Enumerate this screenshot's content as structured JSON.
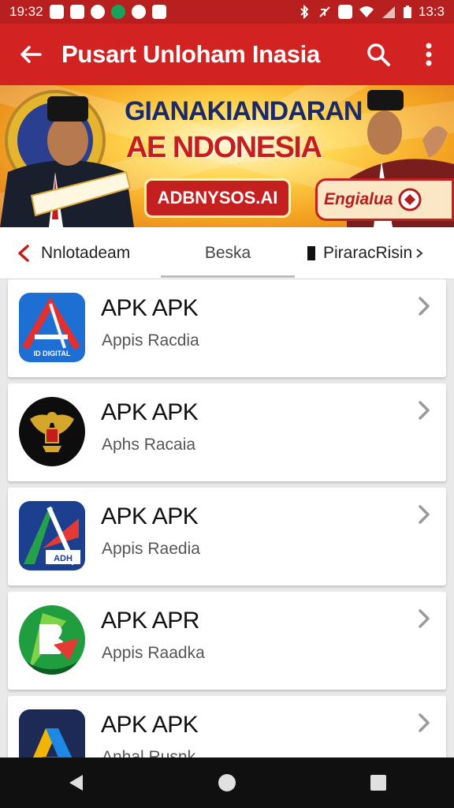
{
  "status_bar": {
    "time": "19:32",
    "right_time": "13:3"
  },
  "app_bar": {
    "title": "Pusart Unloham Inasia"
  },
  "banner": {
    "headline_1": "GIANAKIANDARAN",
    "headline_2": "AE NDONESIA",
    "button_label": "ADBNYSOS.AI",
    "badge_label": "Engialua"
  },
  "tabs": [
    {
      "label": "Nnlotadeam"
    },
    {
      "label": "Beska"
    },
    {
      "label": "PiraracRisin"
    }
  ],
  "apps": [
    {
      "name": "APK APK",
      "subtitle": "Appis Racdia",
      "icon": "red-a-logo-icon",
      "icon_caption": "ID DIGITAL"
    },
    {
      "name": "APK APK",
      "subtitle": "Aphs Racaia",
      "icon": "garuda-emblem-icon"
    },
    {
      "name": "APK APK",
      "subtitle": "Appis Raedia",
      "icon": "ar-logo-icon",
      "icon_caption": "ADH"
    },
    {
      "name": "APK APR",
      "subtitle": "Appis Raadka",
      "icon": "green-b-logo-icon"
    },
    {
      "name": "APK APK",
      "subtitle": "Anhal Rusnk",
      "icon": "multicolor-a-logo-icon"
    }
  ],
  "colors": {
    "status_bar": "#b81f1f",
    "app_bar": "#d32222",
    "nav_bar": "#101010",
    "banner_headline_1": "#1b2a6b",
    "banner_headline_2": "#c81d1d"
  }
}
